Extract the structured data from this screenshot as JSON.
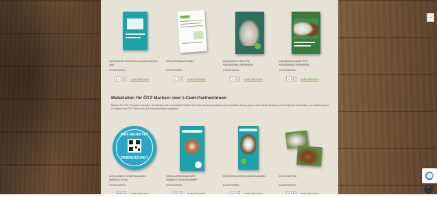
{
  "section1": {
    "products": [
      {
        "title": "Infokarte für Schulungszwecke und",
        "price": "KOSTENFREI",
        "qty": "1",
        "cart": "In den Warenkorb"
      },
      {
        "title": "ÖTZ-Informationen",
        "price": "KOSTENFREI",
        "qty": "1",
        "cart": "In den Warenkorb"
      },
      {
        "title": "Infokarte für ÖTZ Hühnerhalter/innen",
        "price": "KOSTENFREI",
        "qty": "1",
        "cart": "In den Warenkorb"
      },
      {
        "title": "Infobroschüre ÖTZ Hühnerhalter/innen",
        "price": "KOSTENFREI",
        "qty": "1",
        "cart": "In den Warenkorb"
      }
    ]
  },
  "section2": {
    "title": "Materialien für ÖTZ Marken- und 1-Cent-Partner/innen",
    "description": "Marken für ÖTZ Produkte erzeugen, verarbeiten oder vermarkten? Wenn Sie auch eine Lizenznehmer sind, bestellen Sie an gerne unter info@oekotierzucht.de folgende Materialien zur Bestellung von Produkten aus ÖTZ-Tieren und zur Kommunikation ausgeben.",
    "products": [
      {
        "title": "Aufkleber Zusatzhinweis Zweinutzung",
        "price": "KOSTENFREI",
        "qty": "100",
        "cart": "In den Warenkorb",
        "badge_top": "WAS BEDEUTET",
        "badge_bottom": "ZWEINUTZUNG?"
      },
      {
        "title": "Verkaufsschneider Zweinutzungshühner",
        "price": "KOSTENFREI",
        "qty": "10",
        "cart": "In den Warenkorb"
      },
      {
        "title": "Preisschilder Hühnerwandel",
        "price": "KOSTENFREI",
        "qty": "10",
        "cart": "In den Warenkorb"
      },
      {
        "title": "Postkarten",
        "price": "KOSTENFREI",
        "qty": "10",
        "cart": "In den Warenkorb"
      }
    ]
  },
  "ui": {
    "corner_badge": "»",
    "scroll_top": "⌃"
  },
  "colors": {
    "panel": "#e7e2d6",
    "accent_green": "#6a8a3a",
    "badge_blue": "#1e9bb5",
    "teal": "#1aa3a8"
  }
}
